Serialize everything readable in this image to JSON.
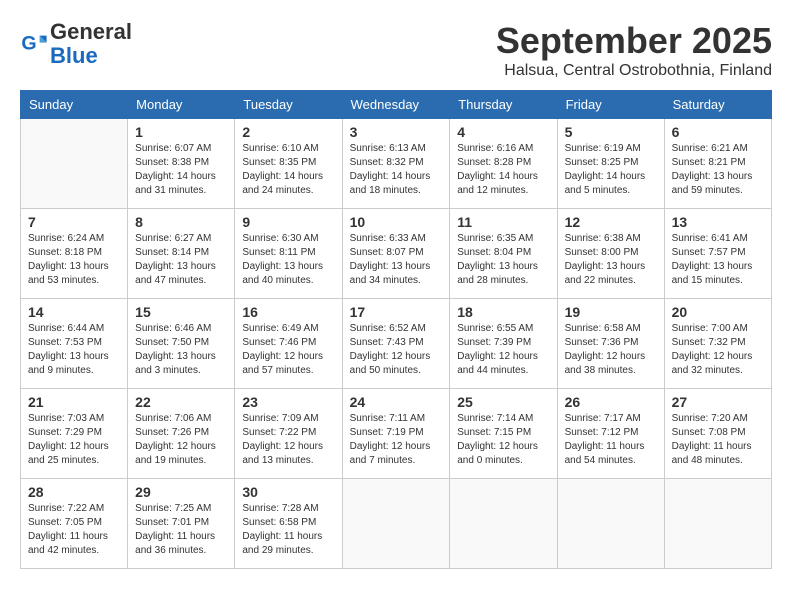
{
  "header": {
    "logo_general": "General",
    "logo_blue": "Blue",
    "month": "September 2025",
    "location": "Halsua, Central Ostrobothnia, Finland"
  },
  "weekdays": [
    "Sunday",
    "Monday",
    "Tuesday",
    "Wednesday",
    "Thursday",
    "Friday",
    "Saturday"
  ],
  "weeks": [
    [
      {
        "day": "",
        "info": ""
      },
      {
        "day": "1",
        "info": "Sunrise: 6:07 AM\nSunset: 8:38 PM\nDaylight: 14 hours\nand 31 minutes."
      },
      {
        "day": "2",
        "info": "Sunrise: 6:10 AM\nSunset: 8:35 PM\nDaylight: 14 hours\nand 24 minutes."
      },
      {
        "day": "3",
        "info": "Sunrise: 6:13 AM\nSunset: 8:32 PM\nDaylight: 14 hours\nand 18 minutes."
      },
      {
        "day": "4",
        "info": "Sunrise: 6:16 AM\nSunset: 8:28 PM\nDaylight: 14 hours\nand 12 minutes."
      },
      {
        "day": "5",
        "info": "Sunrise: 6:19 AM\nSunset: 8:25 PM\nDaylight: 14 hours\nand 5 minutes."
      },
      {
        "day": "6",
        "info": "Sunrise: 6:21 AM\nSunset: 8:21 PM\nDaylight: 13 hours\nand 59 minutes."
      }
    ],
    [
      {
        "day": "7",
        "info": "Sunrise: 6:24 AM\nSunset: 8:18 PM\nDaylight: 13 hours\nand 53 minutes."
      },
      {
        "day": "8",
        "info": "Sunrise: 6:27 AM\nSunset: 8:14 PM\nDaylight: 13 hours\nand 47 minutes."
      },
      {
        "day": "9",
        "info": "Sunrise: 6:30 AM\nSunset: 8:11 PM\nDaylight: 13 hours\nand 40 minutes."
      },
      {
        "day": "10",
        "info": "Sunrise: 6:33 AM\nSunset: 8:07 PM\nDaylight: 13 hours\nand 34 minutes."
      },
      {
        "day": "11",
        "info": "Sunrise: 6:35 AM\nSunset: 8:04 PM\nDaylight: 13 hours\nand 28 minutes."
      },
      {
        "day": "12",
        "info": "Sunrise: 6:38 AM\nSunset: 8:00 PM\nDaylight: 13 hours\nand 22 minutes."
      },
      {
        "day": "13",
        "info": "Sunrise: 6:41 AM\nSunset: 7:57 PM\nDaylight: 13 hours\nand 15 minutes."
      }
    ],
    [
      {
        "day": "14",
        "info": "Sunrise: 6:44 AM\nSunset: 7:53 PM\nDaylight: 13 hours\nand 9 minutes."
      },
      {
        "day": "15",
        "info": "Sunrise: 6:46 AM\nSunset: 7:50 PM\nDaylight: 13 hours\nand 3 minutes."
      },
      {
        "day": "16",
        "info": "Sunrise: 6:49 AM\nSunset: 7:46 PM\nDaylight: 12 hours\nand 57 minutes."
      },
      {
        "day": "17",
        "info": "Sunrise: 6:52 AM\nSunset: 7:43 PM\nDaylight: 12 hours\nand 50 minutes."
      },
      {
        "day": "18",
        "info": "Sunrise: 6:55 AM\nSunset: 7:39 PM\nDaylight: 12 hours\nand 44 minutes."
      },
      {
        "day": "19",
        "info": "Sunrise: 6:58 AM\nSunset: 7:36 PM\nDaylight: 12 hours\nand 38 minutes."
      },
      {
        "day": "20",
        "info": "Sunrise: 7:00 AM\nSunset: 7:32 PM\nDaylight: 12 hours\nand 32 minutes."
      }
    ],
    [
      {
        "day": "21",
        "info": "Sunrise: 7:03 AM\nSunset: 7:29 PM\nDaylight: 12 hours\nand 25 minutes."
      },
      {
        "day": "22",
        "info": "Sunrise: 7:06 AM\nSunset: 7:26 PM\nDaylight: 12 hours\nand 19 minutes."
      },
      {
        "day": "23",
        "info": "Sunrise: 7:09 AM\nSunset: 7:22 PM\nDaylight: 12 hours\nand 13 minutes."
      },
      {
        "day": "24",
        "info": "Sunrise: 7:11 AM\nSunset: 7:19 PM\nDaylight: 12 hours\nand 7 minutes."
      },
      {
        "day": "25",
        "info": "Sunrise: 7:14 AM\nSunset: 7:15 PM\nDaylight: 12 hours\nand 0 minutes."
      },
      {
        "day": "26",
        "info": "Sunrise: 7:17 AM\nSunset: 7:12 PM\nDaylight: 11 hours\nand 54 minutes."
      },
      {
        "day": "27",
        "info": "Sunrise: 7:20 AM\nSunset: 7:08 PM\nDaylight: 11 hours\nand 48 minutes."
      }
    ],
    [
      {
        "day": "28",
        "info": "Sunrise: 7:22 AM\nSunset: 7:05 PM\nDaylight: 11 hours\nand 42 minutes."
      },
      {
        "day": "29",
        "info": "Sunrise: 7:25 AM\nSunset: 7:01 PM\nDaylight: 11 hours\nand 36 minutes."
      },
      {
        "day": "30",
        "info": "Sunrise: 7:28 AM\nSunset: 6:58 PM\nDaylight: 11 hours\nand 29 minutes."
      },
      {
        "day": "",
        "info": ""
      },
      {
        "day": "",
        "info": ""
      },
      {
        "day": "",
        "info": ""
      },
      {
        "day": "",
        "info": ""
      }
    ]
  ]
}
